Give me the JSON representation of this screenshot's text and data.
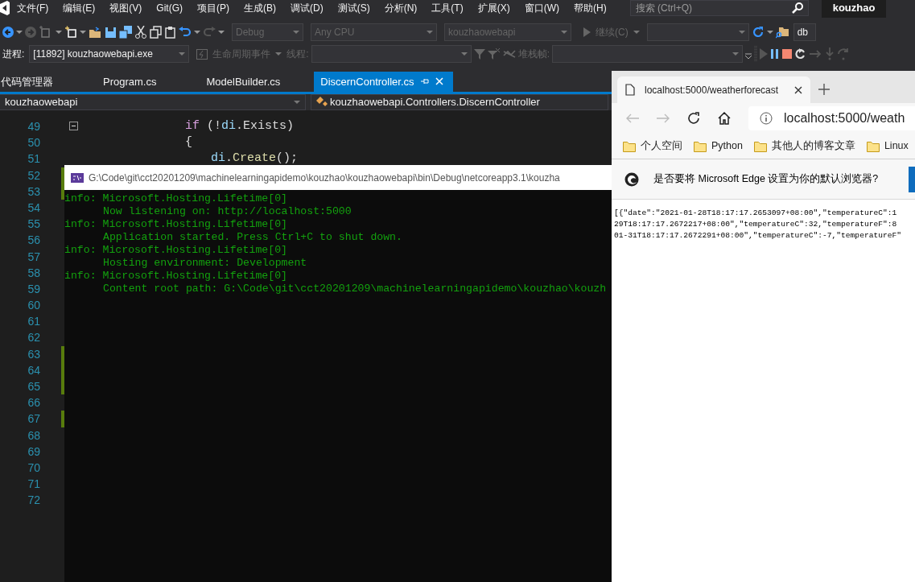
{
  "menu": [
    "文件(F)",
    "编辑(E)",
    "视图(V)",
    "Git(G)",
    "项目(P)",
    "生成(B)",
    "调试(D)",
    "测试(S)",
    "分析(N)",
    "工具(T)",
    "扩展(X)",
    "窗口(W)",
    "帮助(H)"
  ],
  "search": {
    "placeholder": "搜索 (Ctrl+Q)"
  },
  "user": "kouzhao",
  "toolbar": {
    "configuration": "Debug",
    "platform": "Any CPU",
    "startup_project": "kouzhaowebapi",
    "continue": "继续(C)",
    "db": "db"
  },
  "debug_bar": {
    "process_label": "进程:",
    "process": "[11892] kouzhaowebapi.exe",
    "lifecycle": "生命周期事件",
    "thread_label": "线程:",
    "stack_label": "堆栈帧:"
  },
  "tabs": [
    {
      "label": "代码管理器",
      "selected": false
    },
    {
      "label": "Program.cs",
      "selected": false
    },
    {
      "label": "ModelBuilder.cs",
      "selected": false
    },
    {
      "label": "DiscernController.cs",
      "selected": true
    }
  ],
  "nav": {
    "project": "kouzhaowebapi",
    "type": "kouzhaowebapi.Controllers.DiscernController"
  },
  "code": {
    "line_numbers": [
      {
        "number": "49",
        "changed": false
      },
      {
        "number": "50",
        "changed": false
      },
      {
        "number": "51",
        "changed": false
      },
      {
        "number": "52",
        "changed": true
      },
      {
        "number": "53",
        "changed": true
      },
      {
        "number": "54",
        "changed": false
      },
      {
        "number": "55",
        "changed": false
      },
      {
        "number": "56",
        "changed": false
      },
      {
        "number": "57",
        "changed": false
      },
      {
        "number": "58",
        "changed": false
      },
      {
        "number": "59",
        "changed": false
      },
      {
        "number": "60",
        "changed": false
      },
      {
        "number": "61",
        "changed": false
      },
      {
        "number": "62",
        "changed": false
      },
      {
        "number": "63",
        "changed": true
      },
      {
        "number": "64",
        "changed": true
      },
      {
        "number": "65",
        "changed": true
      },
      {
        "number": "66",
        "changed": false
      },
      {
        "number": "67",
        "changed": true
      },
      {
        "number": "68",
        "changed": false
      },
      {
        "number": "69",
        "changed": false
      },
      {
        "number": "70",
        "changed": false
      },
      {
        "number": "71",
        "changed": false
      },
      {
        "number": "72",
        "changed": false
      }
    ],
    "lines": [
      {
        "tokens": [
          {
            "text": "if",
            "kind": "keyword"
          },
          {
            "text": " (!",
            "kind": "plain"
          },
          {
            "text": "di",
            "kind": "variable"
          },
          {
            "text": ".Exists)",
            "kind": "plain"
          }
        ],
        "expanded": true
      },
      {
        "tokens": [
          {
            "text": "{",
            "kind": "plain"
          }
        ],
        "children": [
          {
            "tokens": [
              {
                "text": "di",
                "kind": "variable"
              },
              {
                "text": ".",
                "kind": "plain"
              },
              {
                "text": "Create",
                "kind": "method"
              },
              {
                "text": "();",
                "kind": "plain"
              }
            ]
          }
        ]
      }
    ]
  },
  "console": {
    "title": "G:\\Code\\git\\cct20201209\\machinelearningapidemo\\kouzhao\\kouzhaowebapi\\bin\\Debug\\netcoreapp3.1\\kouzha",
    "lines": [
      {
        "text": "info: Microsoft.Hosting.Lifetime[0]",
        "kind": "header"
      },
      {
        "text": "Now listening on: http://localhost:5000",
        "kind": "message"
      },
      {
        "text": "info: Microsoft.Hosting.Lifetime[0]",
        "kind": "header"
      },
      {
        "text": "Application started. Press Ctrl+C to shut down.",
        "kind": "message"
      },
      {
        "text": "info: Microsoft.Hosting.Lifetime[0]",
        "kind": "header"
      },
      {
        "text": "Hosting environment: Development",
        "kind": "message"
      },
      {
        "text": "info: Microsoft.Hosting.Lifetime[0]",
        "kind": "header"
      },
      {
        "text": "Content root path: G:\\Code\\git\\cct20201209\\machinelearningapidemo\\kouzhao\\kouzh",
        "kind": "message"
      }
    ]
  },
  "browser": {
    "tab": "localhost:5000/weatherforecast",
    "address": "localhost:5000/weath",
    "bookmarks": [
      "个人空间",
      "Python",
      "其他人的博客文章",
      "Linux"
    ],
    "banner": "是否要将 Microsoft Edge 设置为你的默认浏览器?",
    "body_lines": [
      "[{\"date\":\"2021-01-28T18:17:17.2653097+08:00\",\"temperatureC\":1",
      "29T18:17:17.2672217+08:00\",\"temperatureC\":32,\"temperatureF\":8",
      "01-31T18:17:17.2672291+08:00\",\"temperatureC\":-7,\"temperatureF\""
    ]
  }
}
